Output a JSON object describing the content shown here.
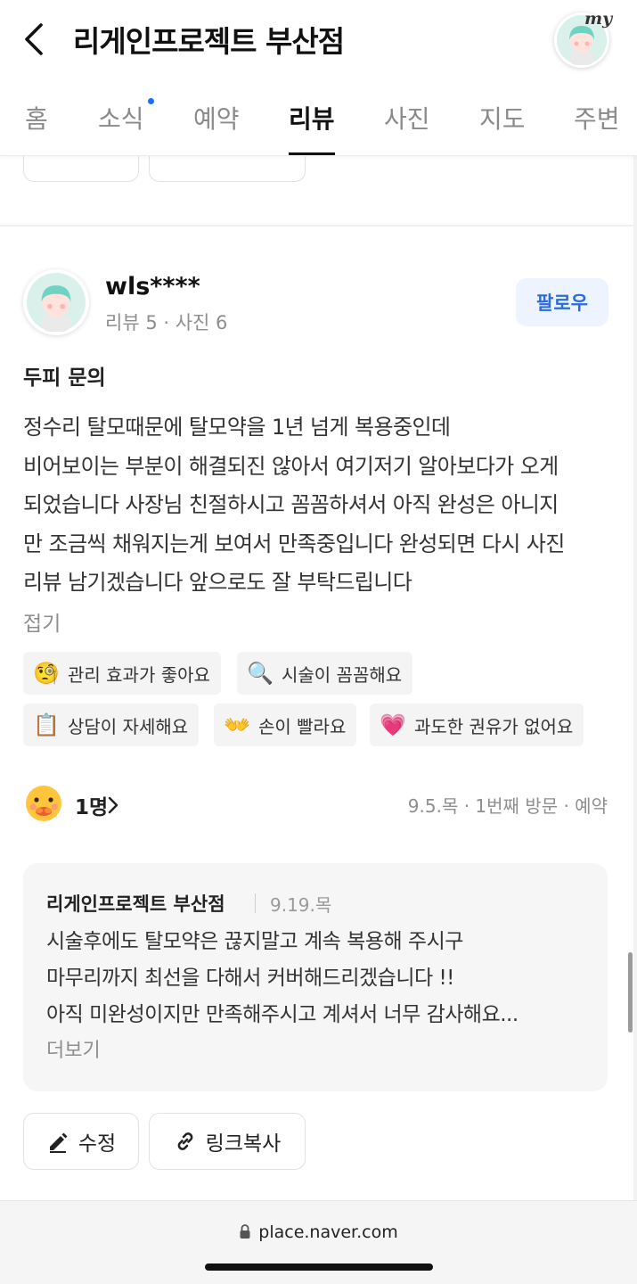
{
  "header": {
    "title": "리게인프로젝트 부산점",
    "my_label": "my"
  },
  "tabs": [
    {
      "label": "홈",
      "active": false
    },
    {
      "label": "소식",
      "active": false,
      "has_new_dot": true
    },
    {
      "label": "예약",
      "active": false
    },
    {
      "label": "리뷰",
      "active": true
    },
    {
      "label": "사진",
      "active": false
    },
    {
      "label": "지도",
      "active": false
    },
    {
      "label": "주변",
      "active": false
    }
  ],
  "review": {
    "reviewer_name": "wls****",
    "reviewer_stats": "리뷰 5 · 사진 6",
    "follow_label": "팔로우",
    "heading": "두피 문의",
    "body_lines": [
      "정수리 탈모때문에 탈모약을 1년 넘게 복용중인데",
      "비어보이는 부분이 해결되진 않아서 여기저기 알아보다가 오게",
      "되었습니다 사장님 친절하시고 꼼꼼하셔서 아직 완성은 아니지",
      "만 조금씩 채워지는게 보여서 만족중입니다 완성되면 다시 사진",
      "리뷰 남기겠습니다 앞으로도 잘 부탁드립니다"
    ],
    "fold_label": "접기",
    "keywords": [
      {
        "emoji": "🧐",
        "label": "관리 효과가 좋아요"
      },
      {
        "emoji": "🔍",
        "label": "시술이 꼼꼼해요"
      },
      {
        "emoji": "📋",
        "label": "상담이 자세해요"
      },
      {
        "emoji": "👐",
        "label": "손이 빨라요"
      },
      {
        "emoji": "💗",
        "label": "과도한 권유가 없어요"
      }
    ],
    "reaction_count": "1명",
    "visit_meta": "9.5.목 · 1번째 방문 · 예약"
  },
  "owner_reply": {
    "owner_name": "리게인프로젝트 부산점",
    "date": "9.19.목",
    "body_lines": [
      "시술후에도 탈모약은 끊지말고 계속 복용해 주시구",
      "마무리까지 최선을 다해서 커버해드리겠습니다 !!",
      "아직 미완성이지만 만족해주시고 계셔서 너무 감사해요..."
    ],
    "more_label": "더보기"
  },
  "actions": {
    "edit_label": "수정",
    "copy_link_label": "링크복사"
  },
  "browser": {
    "url": "place.naver.com"
  },
  "colors": {
    "accent_blue": "#2a6bdf",
    "follow_bg": "#eef4ff",
    "chip_bg": "#f4f4f4",
    "reply_bg": "#f6f6f7"
  }
}
